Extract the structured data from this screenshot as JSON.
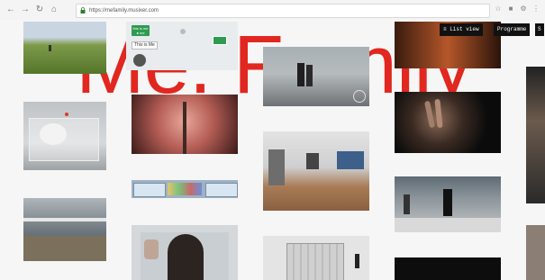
{
  "browser": {
    "url": "https://mefamily.musixer.com",
    "icons": [
      "back-icon",
      "forward-icon",
      "reload-icon",
      "home-icon",
      "lock-icon",
      "star-icon",
      "extension-icon",
      "settings-icon",
      "menu-icon"
    ]
  },
  "page": {
    "title": "Me. Family",
    "menu": {
      "list_view": "List view",
      "programme": "Programme",
      "third": "S"
    },
    "overlay": {
      "green_badge": "this is me ● me",
      "tooltip": "This is Me"
    }
  },
  "colors": {
    "accent_red": "#e1271f",
    "menu_bg": "#111111",
    "badge_green": "#2f9b50"
  }
}
